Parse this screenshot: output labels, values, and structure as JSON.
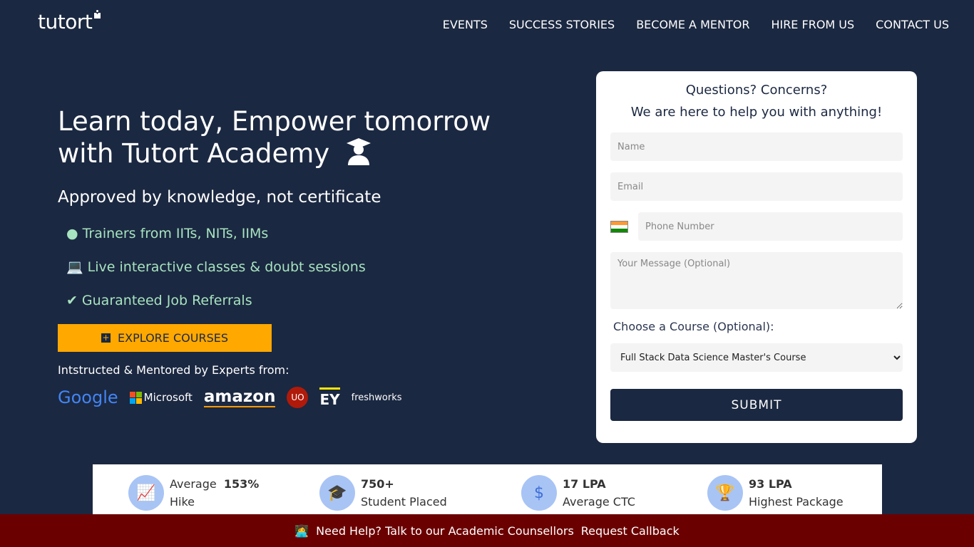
{
  "brand": {
    "name": "tutort"
  },
  "nav": [
    "EVENTS",
    "SUCCESS STORIES",
    "BECOME A MENTOR",
    "HIRE FROM US",
    "CONTACT US"
  ],
  "hero": {
    "title_line1": "Learn today, Empower tomorrow",
    "title_line2": "with Tutort Academy",
    "subtitle": "Approved by knowledge, not certificate",
    "features": [
      {
        "icon": "user-circle-icon",
        "text": "Trainers from IITs, NITs, IIMs"
      },
      {
        "icon": "laptop-icon",
        "text": "Live interactive classes & doubt sessions"
      },
      {
        "icon": "check-circle-icon",
        "text": "Guaranteed Job Referrals"
      }
    ],
    "explore_label": "EXPLORE COURSES",
    "mentored": "Intstructed & Mentored by Experts from:",
    "companies": [
      "Google",
      "Microsoft",
      "amazon",
      "UO",
      "EY",
      "freshworks"
    ]
  },
  "form": {
    "heading1": "Questions? Concerns?",
    "heading2": "We are here to help you with anything!",
    "name_placeholder": "Name",
    "email_placeholder": "Email",
    "phone_placeholder": "Phone Number",
    "message_placeholder": "Your Message (Optional)",
    "course_label": "Choose a Course (Optional):",
    "course_selected": "Full Stack Data Science Master's Course",
    "submit": "SUBMIT"
  },
  "stats": [
    {
      "label": "Average",
      "value": "153%",
      "sub": "Hike",
      "icon": "chart-icon"
    },
    {
      "value": "750+",
      "sub": "Student Placed",
      "icon": "graduate-icon"
    },
    {
      "value": "17 LPA",
      "sub": "Average CTC",
      "icon": "dollar-icon"
    },
    {
      "value": "93 LPA",
      "sub": "Highest Package",
      "icon": "trophy-icon"
    }
  ],
  "footer": {
    "text": "Need Help? Talk to our Academic Counsellors",
    "link": "Request Callback"
  },
  "colors": {
    "background": "#1b2841",
    "accent": "#ffa800",
    "feature_text": "#a7e3bf",
    "footer": "#6b0000"
  }
}
